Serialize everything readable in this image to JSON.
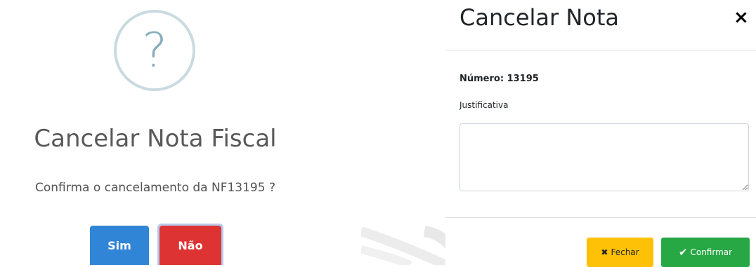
{
  "alert": {
    "icon": "question-icon",
    "icon_glyph": "?",
    "title": "Cancelar Nota Fiscal",
    "text": "Confirma o cancelamento da NF13195 ?",
    "confirm_label": "Sim",
    "cancel_label": "Não",
    "colors": {
      "confirm": "#3085d6",
      "cancel": "#dd3333",
      "icon_border": "#c9dae1",
      "icon_glyph": "#87adbd"
    }
  },
  "modal": {
    "title": "Cancelar Nota",
    "close_glyph": "×",
    "numero_label": "Número: 13195",
    "justificativa_label": "Justificativa",
    "justificativa_value": "",
    "footer": {
      "fechar_label": "Fechar",
      "fechar_icon": "x-icon",
      "fechar_glyph": "✖",
      "confirmar_label": "Confirmar",
      "confirmar_icon": "check-icon",
      "confirmar_glyph": "✔"
    },
    "colors": {
      "fechar": "#ffc107",
      "confirmar": "#28a745"
    }
  }
}
